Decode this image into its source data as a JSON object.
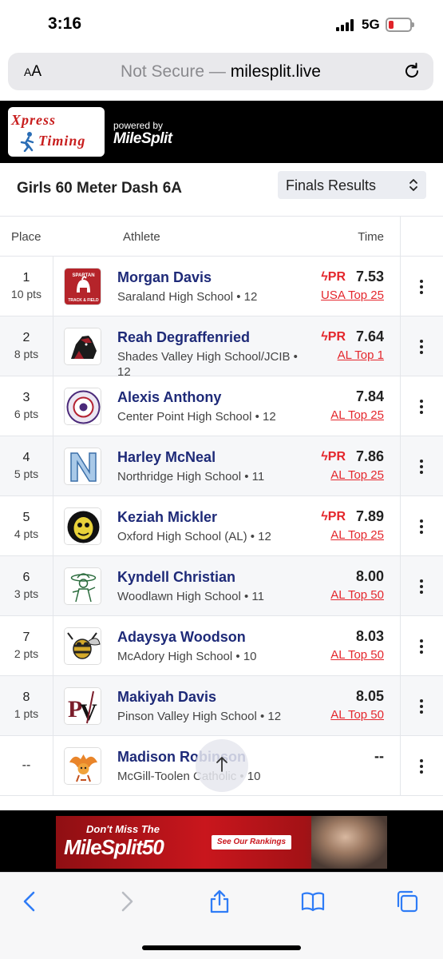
{
  "status": {
    "time": "3:16",
    "network": "5G"
  },
  "browser": {
    "aa_label": "AA",
    "url_prefix": "Not Secure — ",
    "url_host": "milesplit.live"
  },
  "brand": {
    "xpress_line1": "Xpress",
    "xpress_line2": "Timing",
    "powered_by": "powered by",
    "milesplit": "MileSplit"
  },
  "event": {
    "title": "Girls 60 Meter Dash 6A",
    "results_select": "Finals Results"
  },
  "columns": {
    "place": "Place",
    "athlete": "Athlete",
    "time": "Time"
  },
  "rows": [
    {
      "place": "1",
      "pts": "10 pts",
      "name": "Morgan Davis",
      "school": "Saraland High School • 12",
      "pr": "PR",
      "time": "7.53",
      "rank": "USA Top 25",
      "logo": "spartan-logo"
    },
    {
      "place": "2",
      "pts": "8 pts",
      "name": "Reah Degraffenried",
      "school": "Shades Valley High School/JCIB • 12",
      "pr": "PR",
      "time": "7.64",
      "rank": "AL Top 1",
      "logo": "mustang-logo"
    },
    {
      "place": "3",
      "pts": "6 pts",
      "name": "Alexis Anthony",
      "school": "Center Point High School • 12",
      "pr": "",
      "time": "7.84",
      "rank": "AL Top 25",
      "logo": "center-point-logo"
    },
    {
      "place": "4",
      "pts": "5 pts",
      "name": "Harley McNeal",
      "school": "Northridge High School • 11",
      "pr": "PR",
      "time": "7.86",
      "rank": "AL Top 25",
      "logo": "northridge-n-logo"
    },
    {
      "place": "5",
      "pts": "4 pts",
      "name": "Keziah Mickler",
      "school": "Oxford High School (AL) • 12",
      "pr": "PR",
      "time": "7.89",
      "rank": "AL Top 25",
      "logo": "yellow-jacket-logo"
    },
    {
      "place": "6",
      "pts": "3 pts",
      "name": "Kyndell Christian",
      "school": "Woodlawn High School • 11",
      "pr": "",
      "time": "8.00",
      "rank": "AL Top 50",
      "logo": "colonel-logo"
    },
    {
      "place": "7",
      "pts": "2 pts",
      "name": "Adaysya Woodson",
      "school": "McAdory High School • 10",
      "pr": "",
      "time": "8.03",
      "rank": "AL Top 50",
      "logo": "hornet-logo"
    },
    {
      "place": "8",
      "pts": "1 pts",
      "name": "Makiyah Davis",
      "school": "Pinson Valley High School • 12",
      "pr": "",
      "time": "8.05",
      "rank": "AL Top 50",
      "logo": "pv-logo"
    },
    {
      "place": "--",
      "pts": "",
      "name": "Madison Robinson",
      "school": "McGill-Toolen Catholic • 10",
      "pr": "",
      "time": "--",
      "rank": "",
      "logo": "phoenix-logo"
    }
  ],
  "ad": {
    "line1": "Don't Miss The",
    "line2": "MileSplit50",
    "button": "See Our Rankings"
  },
  "colors": {
    "accent_red": "#e4262c",
    "name_navy": "#1e2a78",
    "brand_black": "#000000"
  }
}
